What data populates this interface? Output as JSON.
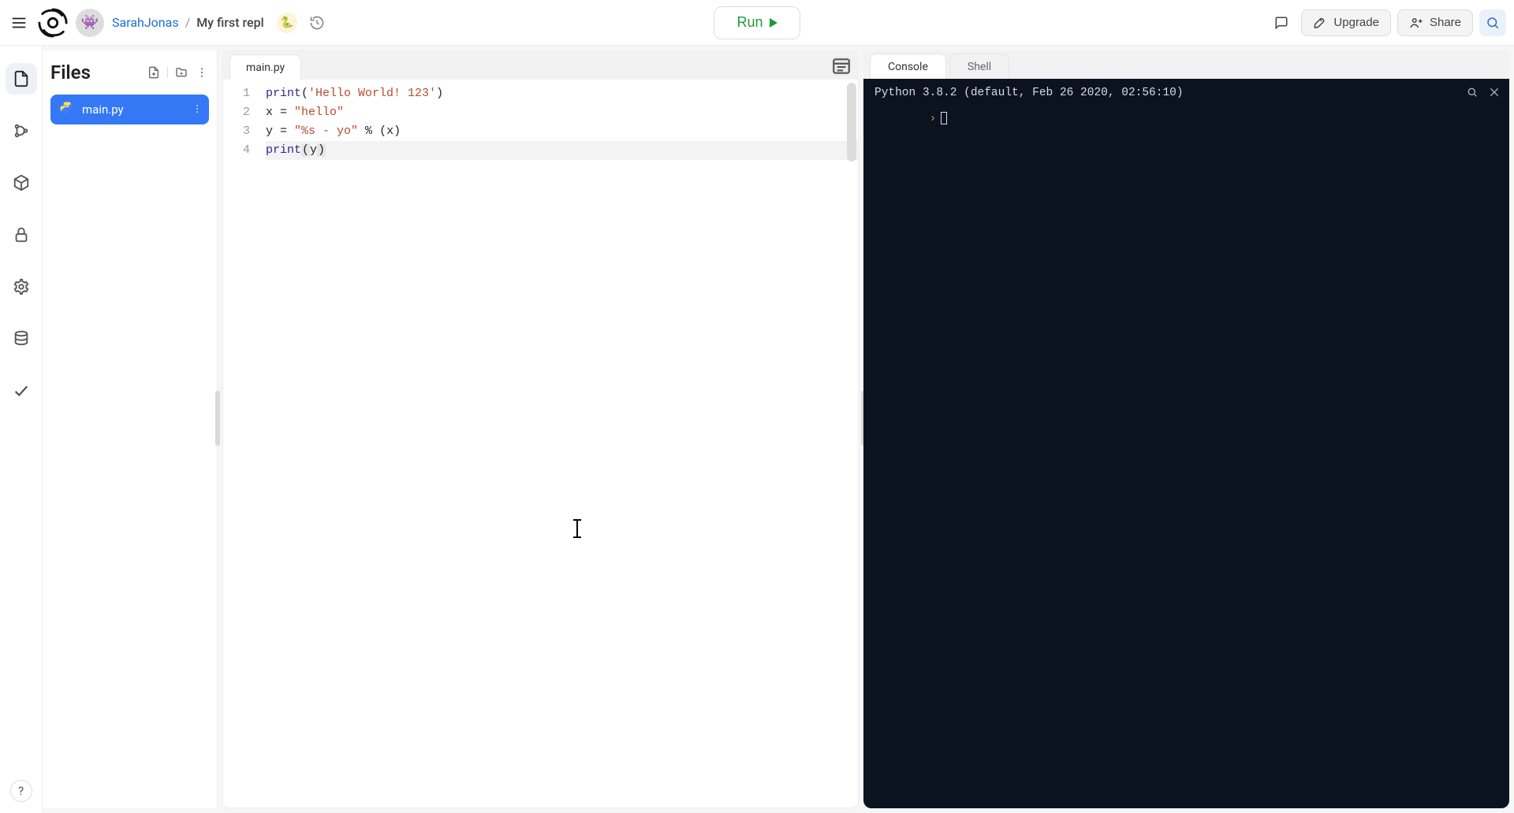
{
  "topbar": {
    "user": "SarahJonas",
    "separator": "/",
    "project": "My first repl",
    "run_label": "Run",
    "upgrade_label": "Upgrade",
    "share_label": "Share",
    "avatar_emoji": "👾",
    "lang_emoji": "🐍"
  },
  "rail": {
    "help_label": "?"
  },
  "sidebar": {
    "title": "Files",
    "files": [
      {
        "name": "main.py"
      }
    ]
  },
  "editor": {
    "tab": "main.py",
    "lines": [
      {
        "n": "1",
        "tokens": [
          {
            "cls": "tok-fn",
            "t": "print"
          },
          {
            "cls": "tok-pun",
            "t": "("
          },
          {
            "cls": "tok-str",
            "t": "'Hello World! 123'"
          },
          {
            "cls": "tok-pun",
            "t": ")"
          }
        ]
      },
      {
        "n": "2",
        "tokens": [
          {
            "cls": "tok-var",
            "t": "x "
          },
          {
            "cls": "tok-op",
            "t": "= "
          },
          {
            "cls": "tok-str",
            "t": "\"hello\""
          }
        ]
      },
      {
        "n": "3",
        "tokens": [
          {
            "cls": "tok-var",
            "t": "y "
          },
          {
            "cls": "tok-op",
            "t": "= "
          },
          {
            "cls": "tok-str",
            "t": "\"%s - yo\""
          },
          {
            "cls": "tok-op",
            "t": " % "
          },
          {
            "cls": "tok-pun",
            "t": "("
          },
          {
            "cls": "tok-var",
            "t": "x"
          },
          {
            "cls": "tok-pun",
            "t": ")"
          }
        ]
      },
      {
        "n": "4",
        "hl": true,
        "tokens": [
          {
            "cls": "tok-fn",
            "t": "print"
          },
          {
            "cls": "tok-pun bracket-hl",
            "t": "("
          },
          {
            "cls": "tok-var",
            "t": "y"
          },
          {
            "cls": "tok-pun bracket-hl",
            "t": ")"
          }
        ]
      }
    ]
  },
  "console": {
    "tabs": [
      {
        "label": "Console",
        "active": true
      },
      {
        "label": "Shell",
        "active": false
      }
    ],
    "header": "Python 3.8.2 (default, Feb 26 2020, 02:56:10)",
    "prompt": ""
  }
}
